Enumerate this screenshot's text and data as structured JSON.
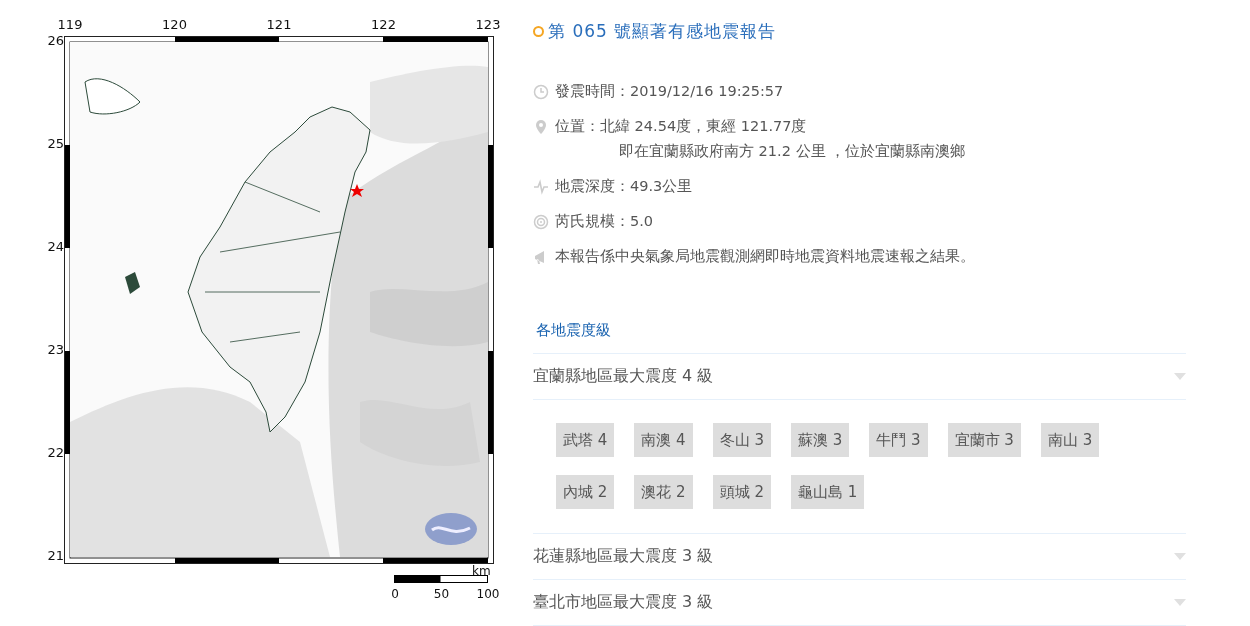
{
  "map": {
    "lon_labels": [
      "119",
      "120",
      "121",
      "122",
      "123"
    ],
    "lat_labels": [
      "26",
      "25",
      "24",
      "23",
      "22",
      "21"
    ],
    "scale": {
      "unit": "km",
      "labels": [
        "0",
        "50",
        "100"
      ]
    }
  },
  "report": {
    "title": "第 065 號顯著有感地震報告",
    "info": [
      {
        "kind": "time",
        "lines": [
          "發震時間：2019/12/16 19:25:57"
        ]
      },
      {
        "kind": "location",
        "lines": [
          "位置：北緯 24.54度，東經 121.77度",
          "即在宜蘭縣政府南方 21.2 公里 ，位於宜蘭縣南澳鄉"
        ]
      },
      {
        "kind": "depth",
        "lines": [
          "地震深度：49.3公里"
        ]
      },
      {
        "kind": "magnitude",
        "lines": [
          "芮氏規模：5.0"
        ]
      },
      {
        "kind": "note",
        "lines": [
          "本報告係中央氣象局地震觀測網即時地震資料地震速報之結果。"
        ]
      }
    ]
  },
  "intensity": {
    "heading": "各地震度級",
    "regions": [
      {
        "title": "宜蘭縣地區最大震度 4 級",
        "stations": [
          "武塔 4",
          "南澳 4",
          "冬山 3",
          "蘇澳 3",
          "牛鬥 3",
          "宜蘭市 3",
          "南山 3",
          "內城 2",
          "澳花 2",
          "頭城 2",
          "龜山島 1"
        ]
      },
      {
        "title": "花蓮縣地區最大震度 3 級"
      },
      {
        "title": "臺北市地區最大震度 3 級"
      }
    ]
  }
}
